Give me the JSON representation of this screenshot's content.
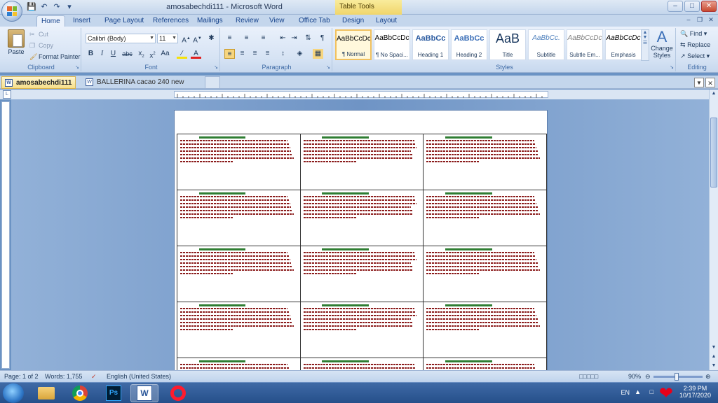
{
  "window": {
    "title": "amosabechdi111 - Microsoft Word",
    "context_tab": "Table Tools"
  },
  "ribbon_tabs": [
    "Home",
    "Insert",
    "Page Layout",
    "References",
    "Mailings",
    "Review",
    "View",
    "Office Tab",
    "Design",
    "Layout"
  ],
  "clipboard": {
    "paste": "Paste",
    "cut": "Cut",
    "copy": "Copy",
    "format_painter": "Format Painter",
    "group": "Clipboard"
  },
  "font": {
    "name": "Calibri (Body)",
    "size": "11",
    "group": "Font"
  },
  "paragraph": {
    "group": "Paragraph"
  },
  "styles": {
    "group": "Styles",
    "items": [
      {
        "sample": "AaBbCcDc",
        "name": "¶ Normal"
      },
      {
        "sample": "AaBbCcDc",
        "name": "¶ No Spaci..."
      },
      {
        "sample": "AaBbCc",
        "name": "Heading 1"
      },
      {
        "sample": "AaBbCc",
        "name": "Heading 2"
      },
      {
        "sample": "AaB",
        "name": "Title"
      },
      {
        "sample": "AaBbCc.",
        "name": "Subtitle"
      },
      {
        "sample": "AaBbCcDc",
        "name": "Subtle Em..."
      },
      {
        "sample": "AaBbCcDc",
        "name": "Emphasis"
      }
    ],
    "change_styles": "Change Styles"
  },
  "editing": {
    "group": "Editing",
    "find": "Find",
    "replace": "Replace",
    "select": "Select"
  },
  "doc_tabs": [
    {
      "label": "amosabechdi111",
      "active": true
    },
    {
      "label": "BALLERINA  cacao  240 new",
      "active": false
    }
  ],
  "statusbar": {
    "page": "Page: 1 of 2",
    "words": "Words: 1,755",
    "language": "English (United States)",
    "zoom": "90%"
  },
  "tray": {
    "lang": "EN",
    "time": "2:39 PM",
    "date": "10/17/2020"
  },
  "colors": {
    "cell_text": "#8b1c1c",
    "cell_header": "#2e7d32"
  }
}
